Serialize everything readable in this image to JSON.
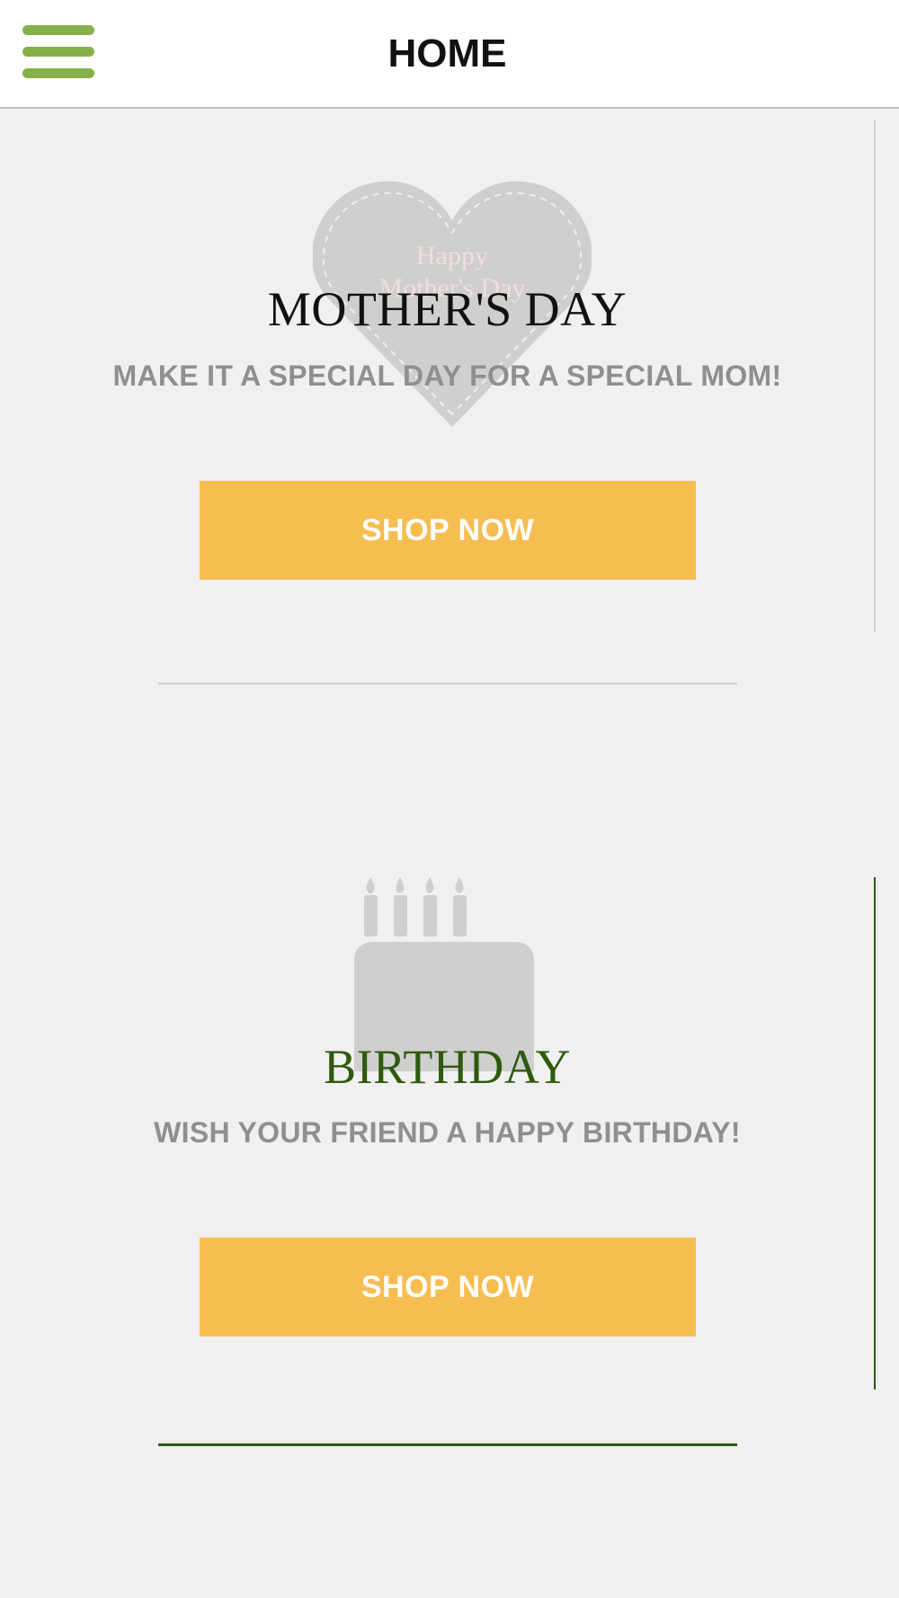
{
  "header": {
    "title": "HOME",
    "menu_icon": "hamburger-menu-icon"
  },
  "colors": {
    "accent_green": "#86b04a",
    "dark_green": "#2f5a0c",
    "button_yellow": "#f6bd50",
    "subtitle_gray": "#8f8f8f",
    "background": "#f0f0f0"
  },
  "sections": [
    {
      "title": "MOTHER'S DAY",
      "subtitle": "MAKE IT A SPECIAL DAY FOR A SPECIAL MOM!",
      "button_label": "SHOP NOW",
      "image_icon": "heart-icon",
      "image_text": [
        "Happy",
        "Mother's Day"
      ]
    },
    {
      "title": "BIRTHDAY",
      "subtitle": "WISH YOUR FRIEND A HAPPY BIRTHDAY!",
      "button_label": "SHOP NOW",
      "image_icon": "birthday-cake-icon"
    }
  ]
}
